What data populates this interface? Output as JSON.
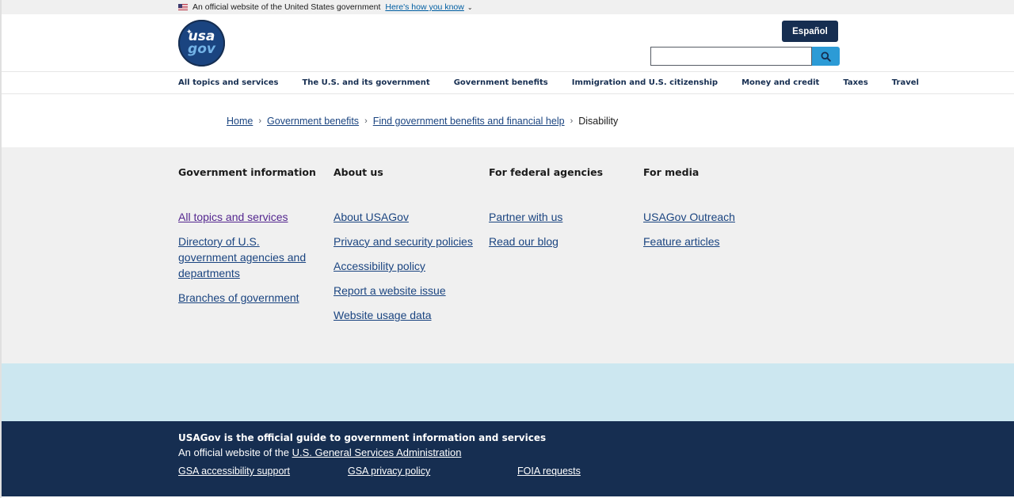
{
  "banner": {
    "official_text": "An official website of the United States government",
    "how_text": "Here's how you know"
  },
  "header": {
    "logo_line1": "usa",
    "logo_line2": "gov",
    "espanol_label": "Español",
    "search_placeholder": ""
  },
  "nav": {
    "items": [
      {
        "label": "All topics and services"
      },
      {
        "label": "The U.S. and its government"
      },
      {
        "label": "Government benefits"
      },
      {
        "label": "Immigration and U.S. citizenship"
      },
      {
        "label": "Money and credit"
      },
      {
        "label": "Taxes"
      },
      {
        "label": "Travel"
      }
    ]
  },
  "breadcrumb": {
    "items": [
      {
        "label": "Home"
      },
      {
        "label": "Government benefits"
      },
      {
        "label": "Find government benefits and financial help"
      }
    ],
    "current": "Disability"
  },
  "footer_columns": [
    {
      "heading": "Government information",
      "links": [
        "All topics and services",
        "Directory of U.S. government agencies and departments",
        "Branches of government"
      ]
    },
    {
      "heading": "About us",
      "links": [
        "About USAGov",
        "Privacy and security policies",
        "Accessibility policy",
        "Report a website issue",
        "Website usage data"
      ]
    },
    {
      "heading": "For federal agencies",
      "links": [
        "Partner with us",
        "Read our blog"
      ]
    },
    {
      "heading": "For media",
      "links": [
        "USAGov Outreach",
        "Feature articles"
      ]
    }
  ],
  "bottom": {
    "tagline": "USAGov is the official guide to government information and services",
    "official_prefix": "An official website of the",
    "gsa_link": "U.S. General Services Administration",
    "links": [
      "GSA accessibility support",
      "GSA privacy policy",
      "FOIA requests"
    ]
  },
  "colors": {
    "navy": "#162e51",
    "link": "#1a4480",
    "visited": "#54278f",
    "search_button": "#2c9bd6",
    "light_band": "#cce7f0"
  }
}
